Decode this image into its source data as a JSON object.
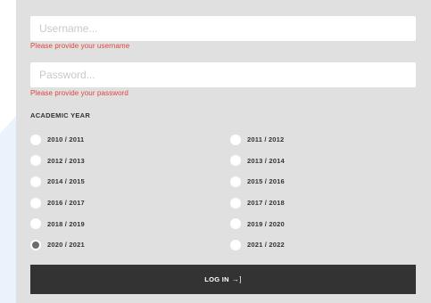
{
  "form": {
    "username": {
      "value": "",
      "placeholder": "Username..."
    },
    "username_error": "Please provide your username",
    "password": {
      "value": "",
      "placeholder": "Password..."
    },
    "password_error": "Please provide your password",
    "section_title": "ACADEMIC YEAR",
    "years": [
      {
        "label": "2010 / 2011",
        "selected": false
      },
      {
        "label": "2011 / 2012",
        "selected": false
      },
      {
        "label": "2012 / 2013",
        "selected": false
      },
      {
        "label": "2013 / 2014",
        "selected": false
      },
      {
        "label": "2014 / 2015",
        "selected": false
      },
      {
        "label": "2015 / 2016",
        "selected": false
      },
      {
        "label": "2016 / 2017",
        "selected": false
      },
      {
        "label": "2017 / 2018",
        "selected": false
      },
      {
        "label": "2018 / 2019",
        "selected": false
      },
      {
        "label": "2019 / 2020",
        "selected": false
      },
      {
        "label": "2020 / 2021",
        "selected": true
      },
      {
        "label": "2021 / 2022",
        "selected": false
      }
    ],
    "login_label": "LOG IN",
    "login_icon": "login-arrow-icon"
  },
  "colors": {
    "panel_bg": "#e0e0e0",
    "error": "#e0443f",
    "button_bg": "#333333",
    "accent_shape": "#e8f1fb"
  }
}
